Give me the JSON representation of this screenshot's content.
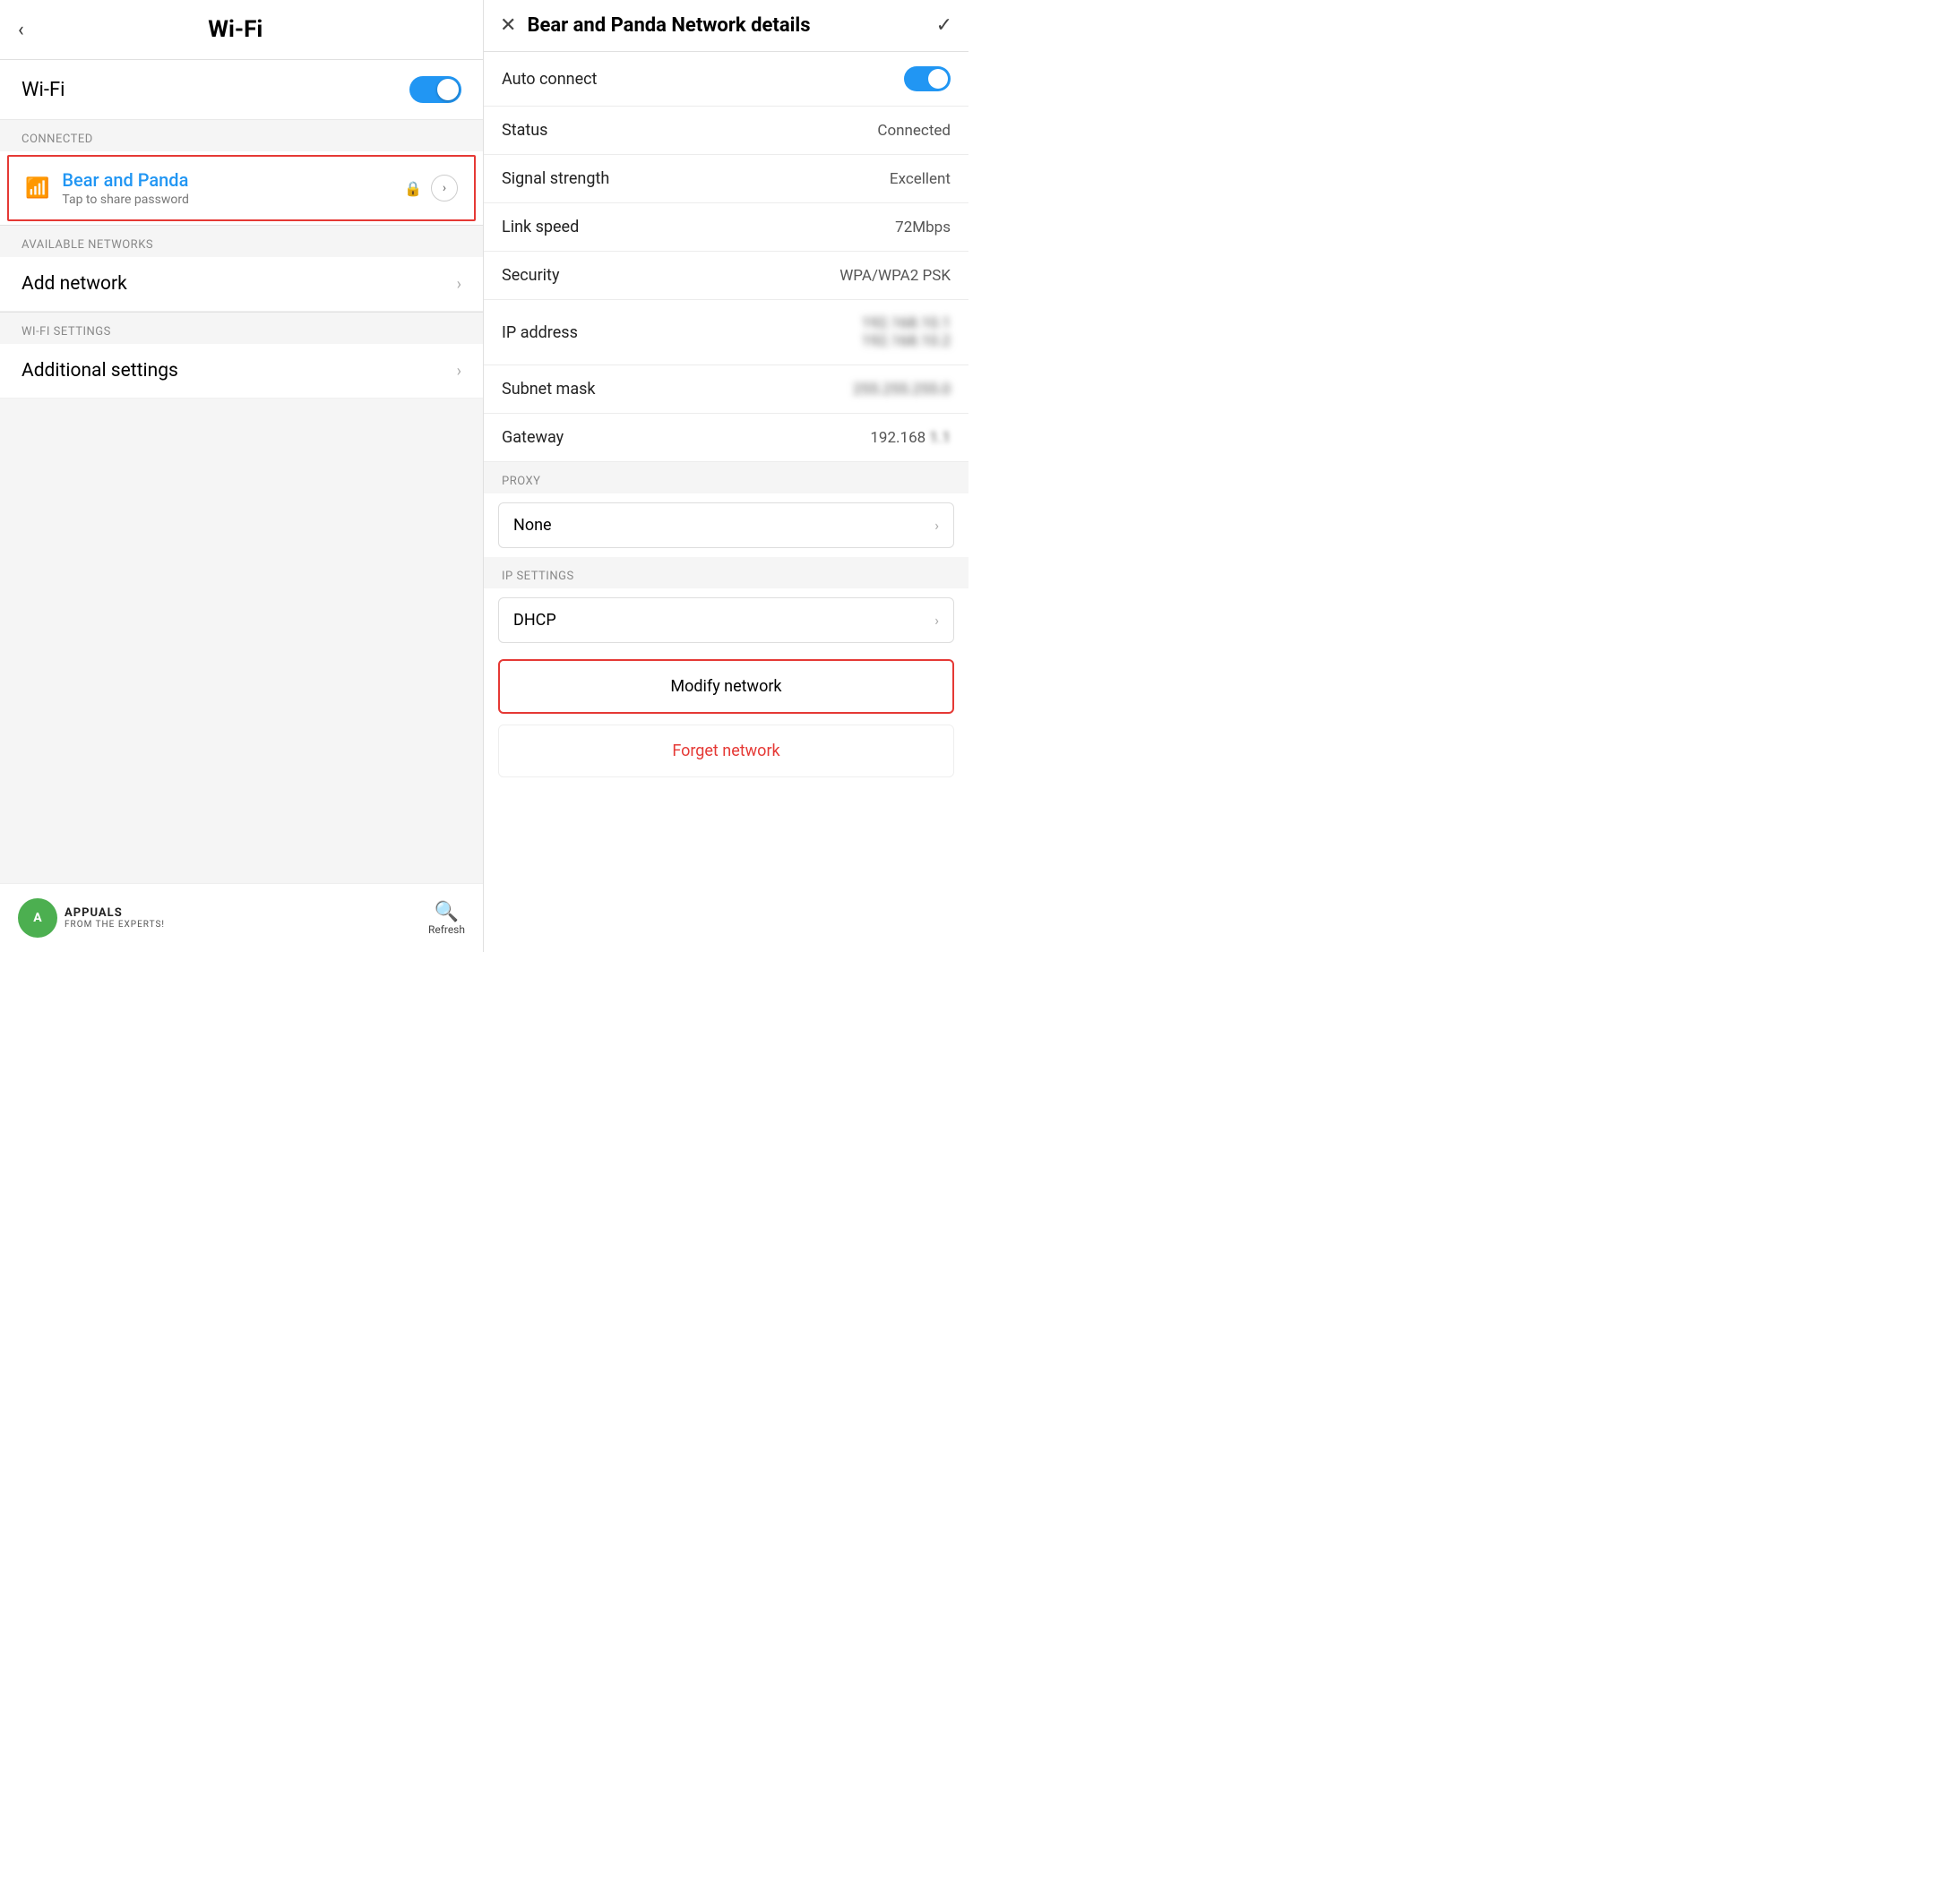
{
  "left": {
    "back_arrow": "‹",
    "title": "Wi-Fi",
    "wifi_label": "Wi-Fi",
    "connected_label": "CONNECTED",
    "network_name": "Bear and Panda",
    "network_sub": "Tap to share password",
    "available_label": "AVAILABLE NETWORKS",
    "add_network": "Add network",
    "wifi_settings_label": "WI-FI SETTINGS",
    "additional_settings": "Additional settings",
    "refresh_label": "Refresh",
    "logo_main": "APPUALS",
    "logo_sub": "FROM THE EXPERTS!"
  },
  "right": {
    "close_icon": "✕",
    "title": "Bear and Panda Network details",
    "check_icon": "✓",
    "rows": [
      {
        "label": "Auto connect",
        "value": "",
        "type": "toggle"
      },
      {
        "label": "Status",
        "value": "Connected",
        "type": "text"
      },
      {
        "label": "Signal strength",
        "value": "Excellent",
        "type": "text"
      },
      {
        "label": "Link speed",
        "value": "72Mbps",
        "type": "text"
      },
      {
        "label": "Security",
        "value": "WPA/WPA2 PSK",
        "type": "text"
      },
      {
        "label": "IP address",
        "value": "192.168.10.1",
        "type": "blurred"
      },
      {
        "label": "Subnet mask",
        "value": "255.255.255.0",
        "type": "blurred"
      },
      {
        "label": "Gateway",
        "value": "192.168.1.1",
        "type": "semi-blurred"
      }
    ],
    "proxy_label": "PROXY",
    "proxy_value": "None",
    "ip_settings_label": "IP SETTINGS",
    "ip_settings_value": "DHCP",
    "modify_network": "Modify network",
    "forget_network": "Forget network"
  }
}
